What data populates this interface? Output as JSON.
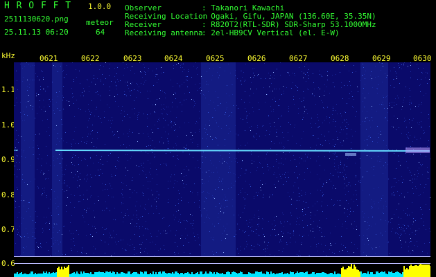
{
  "app": {
    "name": "H R O F F T",
    "version": "1.0.0",
    "filename": "2511130620.png",
    "datetime": "25.11.13 06:20",
    "detect_label": "meteor",
    "detect_count": "64"
  },
  "info": {
    "observer_label": "Observer",
    "observer_value": ": Takanori Kawachi",
    "location_label": "Receiving Location",
    "location_value": ": Ogaki, Gifu, JAPAN (136.60E, 35.35N)",
    "receiver_label": "Receiver",
    "receiver_value": ": R820T2(RTL-SDR) SDR-Sharp 53.1000MHz",
    "antenna_label": "Receiving antenna",
    "antenna_value": ": 2el-HB9CV Vertical (el. E-W)"
  },
  "axis": {
    "y_unit": "kHz",
    "y_ticks": [
      "1.1",
      "1.0",
      "0.9",
      "0.8",
      "0.7",
      "0.6"
    ],
    "x_ticks": [
      "0621",
      "0622",
      "0623",
      "0624",
      "0625",
      "0626",
      "0627",
      "0628",
      "0629",
      "0630"
    ]
  },
  "colors": {
    "background": "#000000",
    "plot_bg": "#0a0a6a",
    "text_green": "#33ff33",
    "text_yellow": "#ffff33",
    "trace": "#66ddff",
    "level_cyan": "#00e5ff",
    "level_yellow": "#ffff00"
  }
}
